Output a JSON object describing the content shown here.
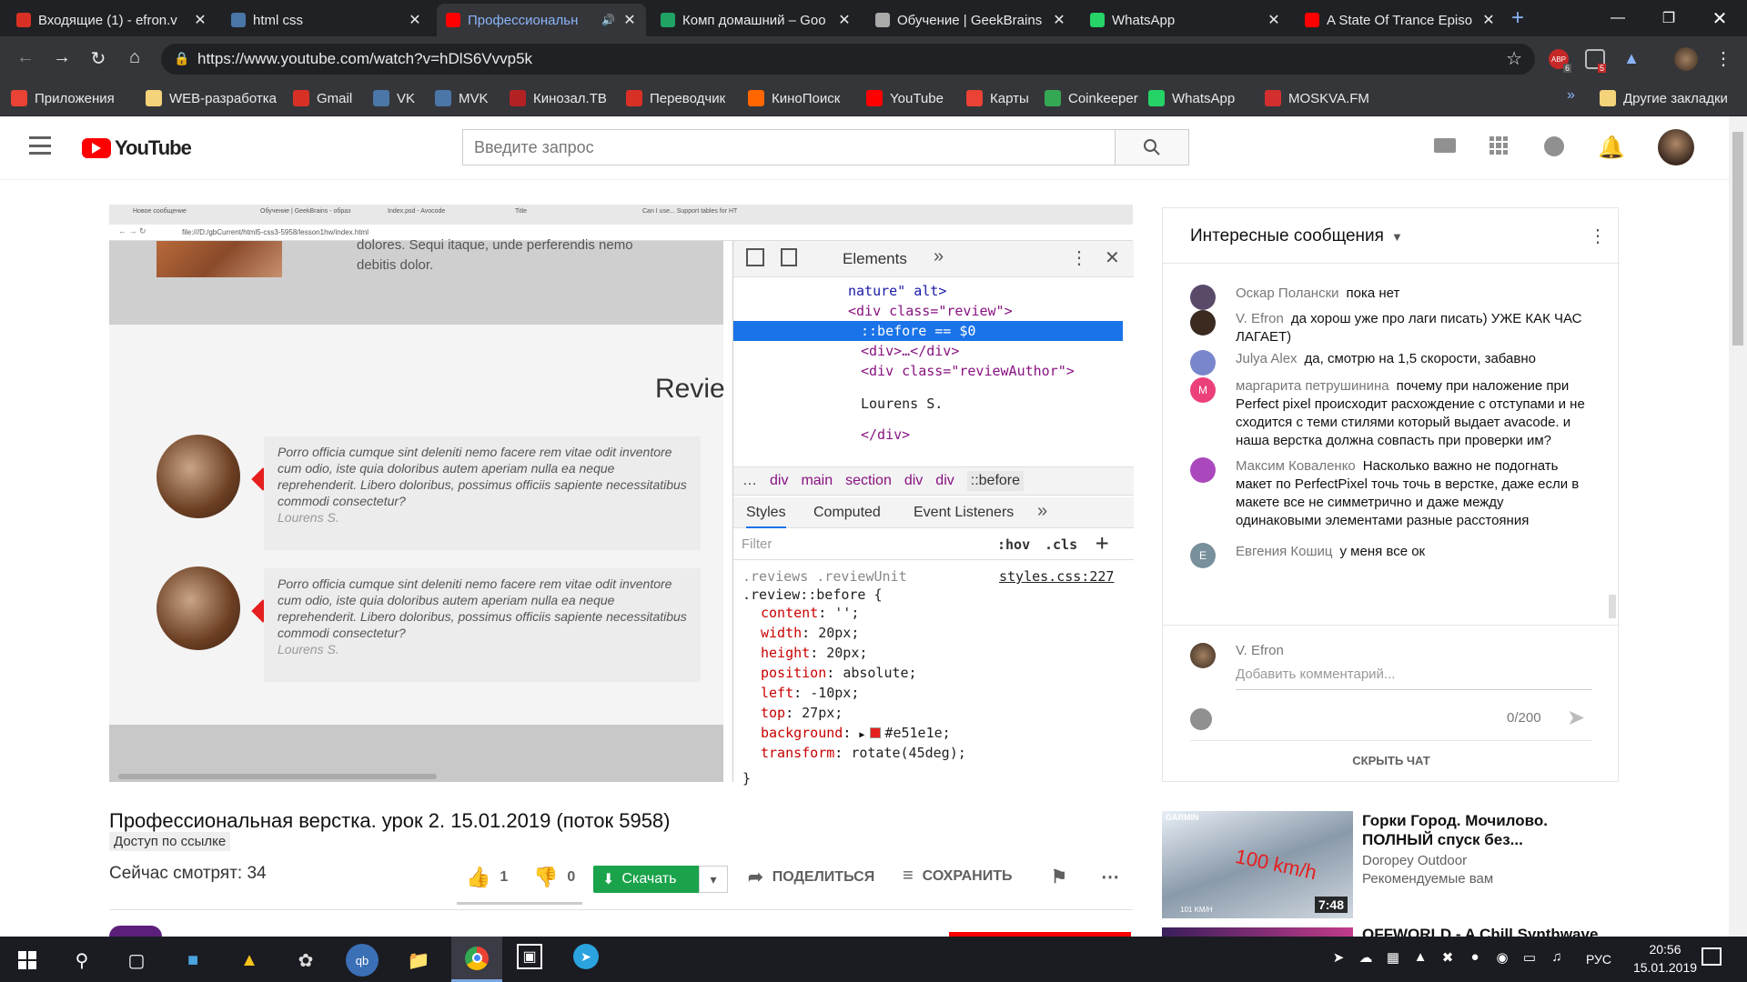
{
  "browser": {
    "tabs": [
      {
        "title": "Входящие (1) - efron.v",
        "favicon": "gmail-icon",
        "favcolor": "#d93025"
      },
      {
        "title": "html css",
        "favicon": "vk-icon",
        "favcolor": "#4a76a8"
      },
      {
        "title": "Профессиональн",
        "favicon": "youtube-icon",
        "favcolor": "#ff0000",
        "active": true
      },
      {
        "title": "Комп домашний – Goo",
        "favicon": "google-drive-icon",
        "favcolor": "#1fa463"
      },
      {
        "title": "Обучение | GeekBrains",
        "favicon": "geekbrains-icon",
        "favcolor": "#aaaaaa"
      },
      {
        "title": "WhatsApp",
        "favicon": "whatsapp-icon",
        "favcolor": "#25d366"
      },
      {
        "title": "A State Of Trance Episo",
        "favicon": "youtube-icon",
        "favcolor": "#ff0000"
      }
    ],
    "url": "https://www.youtube.com/watch?v=hDlS6Vvvp5k",
    "bookmarks": [
      {
        "label": "Приложения",
        "icon": "apps-icon",
        "color": "#ea4335"
      },
      {
        "label": "WEB-разработка",
        "icon": "folder-icon",
        "color": "#f4d37a"
      },
      {
        "label": "Gmail",
        "icon": "gmail-icon",
        "color": "#d93025"
      },
      {
        "label": "VK",
        "icon": "vk-icon",
        "color": "#4a76a8"
      },
      {
        "label": "MVK",
        "icon": "vk-icon",
        "color": "#4a76a8"
      },
      {
        "label": "Кинозал.ТВ",
        "icon": "kinozal-icon",
        "color": "#b22222"
      },
      {
        "label": "Переводчик",
        "icon": "translate-icon",
        "color": "#d93025"
      },
      {
        "label": "КиноПоиск",
        "icon": "kinopoisk-icon",
        "color": "#ff6600"
      },
      {
        "label": "YouTube",
        "icon": "youtube-icon",
        "color": "#ff0000"
      },
      {
        "label": "Карты",
        "icon": "maps-pin-icon",
        "color": "#ea4335"
      },
      {
        "label": "Coinkeeper",
        "icon": "coinkeeper-icon",
        "color": "#34a853"
      },
      {
        "label": "WhatsApp",
        "icon": "whatsapp-icon",
        "color": "#25d366"
      },
      {
        "label": "MOSKVA.FM",
        "icon": "moskvafm-icon",
        "color": "#d32f2f"
      }
    ],
    "other_bookmarks": "Другие закладки",
    "badges": {
      "abp": "6",
      "ext": "5"
    }
  },
  "youtube": {
    "logo": "YouTube",
    "search_placeholder": "Введите запрос",
    "video": {
      "page_tabs": [
        "Новое сообщение",
        "Обучение | GeekBrains - образ",
        "Index.psd - Avocode",
        "Title",
        "Can I use... Support tables for HT"
      ],
      "page_url": "file:///D:/gbCurrent/html5-css3-5958/lesson1hw/index.html",
      "top_text_1": "dolores. Sequi itaque, unde perferendis nemo",
      "top_text_2": "debitis dolor.",
      "heading": "Revie",
      "review_text": "Porro officia cumque sint deleniti nemo facere rem vitae odit inventore cum odio, iste quia doloribus autem aperiam nulla ea neque reprehenderit. Libero doloribus, possimus officiis sapiente necessitatibus commodi consectetur?",
      "review_author": "Lourens S.",
      "devtools": {
        "panel": "Elements",
        "dom_lines": [
          {
            "kind": "url",
            "text": "nature\" alt>"
          },
          {
            "kind": "open",
            "text": "<div class=\"review\">"
          },
          {
            "kind": "selected",
            "text": "::before == $0"
          },
          {
            "kind": "collapsed",
            "text": "<div>…</div>"
          },
          {
            "kind": "open2",
            "text": "<div class=\"reviewAuthor\">"
          },
          {
            "kind": "text",
            "text": "Lourens S."
          },
          {
            "kind": "close",
            "text": "</div>"
          }
        ],
        "breadcrumbs": [
          "…",
          "div",
          "main",
          "section",
          "div",
          "div",
          "::before"
        ],
        "subtabs": [
          "Styles",
          "Computed",
          "Event Listeners"
        ],
        "filter_placeholder": "Filter",
        "hov": ":hov",
        "cls": ".cls",
        "rule_source": "styles.css:227",
        "selector_1": ".reviews .reviewUnit",
        "selector_2": ".review::before {",
        "declarations": [
          {
            "prop": "content",
            "value": "'';"
          },
          {
            "prop": "width",
            "value": "20px;"
          },
          {
            "prop": "height",
            "value": "20px;"
          },
          {
            "prop": "position",
            "value": "absolute;"
          },
          {
            "prop": "left",
            "value": "-10px;"
          },
          {
            "prop": "top",
            "value": "27px;"
          },
          {
            "prop": "background",
            "value": "#e51e1e;"
          },
          {
            "prop": "transform",
            "value": "rotate(45deg);"
          }
        ],
        "swatch_color": "#e51e1e",
        "closing_brace": "}"
      }
    },
    "title": "Профессиональная верстка. урок 2. 15.01.2019 (поток 5958)",
    "access_badge": "Доступ по ссылке",
    "viewers": "Сейчас смотрят: 34",
    "likes": "1",
    "dislikes": "0",
    "download_label": "Скачать",
    "share_label": "ПОДЕЛИТЬСЯ",
    "save_label": "СОХРАНИТЬ",
    "chat": {
      "title": "Интересные сообщения",
      "messages": [
        {
          "author": "Оскар Полански",
          "text": "пока нет",
          "avatar_color": "#5a4a6a",
          "initial": ""
        },
        {
          "author": "V. Efron",
          "text": "да хорош уже про лаги писать) УЖЕ КАК ЧАС ЛАГАЕТ)",
          "avatar_color": "#3b2a20",
          "initial": ""
        },
        {
          "author": "Julya Alex",
          "text": "да, смотрю на 1,5 скорости, забавно",
          "avatar_color": "#7986cb",
          "initial": ""
        },
        {
          "author": "маргарита петрушинина",
          "text": "почему при наложение при Perfect pixel происходит расхождение с отступами и не сходится с теми стилями который выдает avacode. и наша верстка должна совпасть при проверки им?",
          "avatar_color": "#ec407a",
          "initial": "М"
        },
        {
          "author": "Максим Коваленко",
          "text": "Насколько важно не подогнать макет по PerfectPixel точь точь в верстке, даже если в макете все не симметрично и даже между одинаковыми элементами разные расстояния",
          "avatar_color": "#ab47bc",
          "initial": ""
        },
        {
          "author": "Евгения Кошиц",
          "text": "у меня все ок",
          "avatar_color": "#78909c",
          "initial": "Е"
        }
      ],
      "compose_author": "V. Efron",
      "compose_placeholder": "Добавить комментарий...",
      "counter": "0/200",
      "hide_chat": "СКРЫТЬ ЧАТ"
    },
    "recommendation": {
      "title": "Горки Город. Мочилово. ПОЛНЫЙ спуск без...",
      "channel": "Doropey Outdoor",
      "sub": "Рекомендуемые вам",
      "duration": "7:48",
      "thumb_brand": "GARMIN",
      "thumb_overlay": "100 km/h",
      "thumb_speed": "101 KM/H",
      "next_title": "OFFWORLD - A Chill Synthwave"
    }
  },
  "taskbar": {
    "time": "20:56",
    "date": "15.01.2019",
    "lang": "РУС"
  }
}
